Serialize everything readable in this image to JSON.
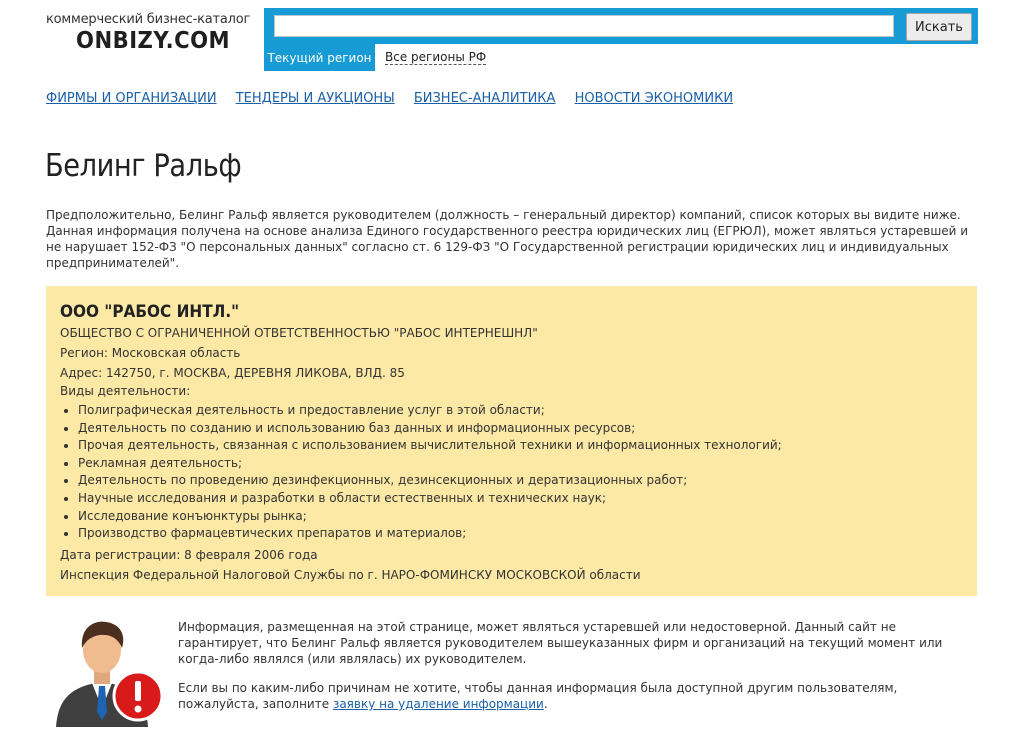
{
  "header": {
    "tagline": "коммерческий бизнес-каталог",
    "brand": "ONBIZY.COM",
    "search": {
      "placeholder": "",
      "button_label": "Искать"
    },
    "tabs": {
      "current_region": "Текущий регион",
      "all_regions": "Все регионы РФ"
    }
  },
  "nav": {
    "items": [
      {
        "label": "ФИРМЫ И ОРГАНИЗАЦИИ"
      },
      {
        "label": "ТЕНДЕРЫ И АУКЦИОНЫ"
      },
      {
        "label": "БИЗНЕС-АНАЛИТИКА"
      },
      {
        "label": "НОВОСТИ ЭКОНОМИКИ"
      }
    ]
  },
  "page": {
    "title": "Белинг Ральф",
    "intro": "Предположительно, Белинг Ральф является руководителем (должность – генеральный директор) компаний, список которых вы видите ниже. Данная информация получена на основе анализа Единого государственного реестра юридических лиц (ЕГРЮЛ), может являться устаревшей и не нарушает 152-ФЗ \"О персональных данных\" согласно ст. 6 129-ФЗ \"О Государственной регистрации юридических лиц и индивидуальных предпринимателей\"."
  },
  "company": {
    "name": "ООО \"РАБОС ИНТЛ.\"",
    "full_name": "ОБЩЕСТВО С ОГРАНИЧЕННОЙ ОТВЕТСТВЕННОСТЬЮ \"РАБОС ИНТЕРНЕШНЛ\"",
    "region": "Регион: Московская область",
    "address": "Адрес: 142750, г. МОСКВА, ДЕРЕВНЯ ЛИКОВА, ВЛД. 85",
    "activities_label": "Виды деятельности:",
    "activities": [
      "Полиграфическая деятельность и предоставление услуг в этой области;",
      "Деятельность по созданию и использованию баз данных и информационных ресурсов;",
      "Прочая деятельность, связанная с использованием вычислительной техники и информационных технологий;",
      "Рекламная деятельность;",
      "Деятельность по проведению дезинфекционных, дезинсекционных и дератизационных работ;",
      "Научные исследования и разработки в области естественных и технических наук;",
      "Исследование конъюнктуры рынка;",
      "Производство фармацевтических препаратов и материалов;"
    ],
    "registration_date": "Дата регистрации: 8 февраля 2006 года",
    "tax_inspection": "Инспекция Федеральной Налоговой Службы по г. НАРО-ФОМИНСКУ МОСКОВСКОЙ области"
  },
  "footer": {
    "disclaimer": "Информация, размещенная на этой странице, может являться устаревшей или недостоверной. Данный сайт не гарантирует, что Белинг Ральф является руководителем вышеуказанных фирм и организаций на текущий момент или когда-либо являлся (или являлась) их руководителем.",
    "removal_text": "Если вы по каким-либо причинам не хотите, чтобы данная информация была доступной другим пользователям, пожалуйста, заполните",
    "removal_link": "заявку на удаление информации",
    "removal_end": "."
  },
  "icons": {
    "avatar": "person-with-warning-icon"
  },
  "colors": {
    "accent": "#169bd5",
    "card_bg": "#fde9a6",
    "link": "#1a5fa8",
    "warning": "#d91a1a"
  }
}
